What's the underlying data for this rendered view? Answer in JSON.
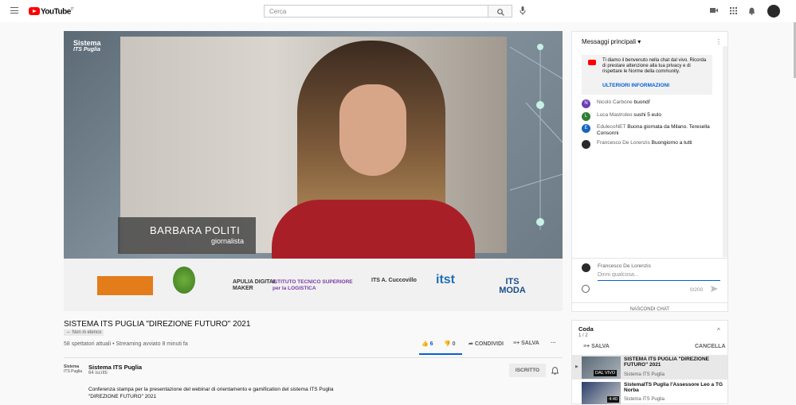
{
  "header": {
    "logo_text": "YouTube",
    "logo_sup": "IT",
    "search_placeholder": "Cerca"
  },
  "player": {
    "brand_line1": "Sistema",
    "brand_line2": "ITS Puglia",
    "lower_third_name": "BARBARA POLITI",
    "lower_third_role": "giornalista",
    "sponsors": [
      "APULIA DIGITAL MAKER",
      "ISTITUTO TECNICO SUPERIORE per la LOGISTICA",
      "ITS A. Cuccovillo",
      "itst",
      "ITS MODA"
    ]
  },
  "chat": {
    "header": "Messaggi principali",
    "welcome_text": "Ti diamo il benvenuto nella chat dal vivo. Ricorda di prestare attenzione alla tua privacy e di rispettare le Norme della community.",
    "welcome_link": "ULTERIORI INFORMAZIONI",
    "messages": [
      {
        "initial": "N",
        "author": "Nicolò Carbone",
        "text": "buondi'",
        "color": "#6a3fb5"
      },
      {
        "initial": "L",
        "author": "Luca Mastroleo",
        "text": "sushi 5 eulo",
        "color": "#2e7d32"
      },
      {
        "initial": "E",
        "author": "EdulecoNET",
        "text": "Buona giornata da Milano. Teresella Consonni",
        "color": "#1565c0"
      },
      {
        "initial": "",
        "author": "Francesco De Lorenzis",
        "text": "Buongiorno a tutti",
        "color": "#2a2a2a"
      }
    ],
    "composer_name": "Francesco De Lorenzis",
    "composer_placeholder": "Dinni qualcosa...",
    "char_count": "0/200",
    "hide_chat": "NASCONDI CHAT"
  },
  "video": {
    "title": "SISTEMA ITS PUGLIA \"DIREZIONE FUTURO\" 2021",
    "visibility": "Non in elenco",
    "meta": "58 spettatori attuali • Streaming avviato 8 minuti fa",
    "likes": "6",
    "dislikes": "0",
    "share": "CONDIVIDI",
    "save": "SALVA",
    "channel": "Sistema ITS Puglia",
    "subscribers": "64 iscritti",
    "subscribed": "ISCRITTO",
    "description": "Conferenza stampa per la presentazione del webinar di orientamento e gamification del sistema ITS Puglia \"DIREZIONE FUTURO\" 2021"
  },
  "queue": {
    "title": "Coda",
    "count": "1 / 2",
    "save": "SALVA",
    "cancel": "CANCELLA",
    "items": [
      {
        "title": "SISTEMA ITS PUGLIA \"DIREZIONE FUTURO\" 2021",
        "channel": "Sistema ITS Puglia",
        "badge": "DAL VIVO"
      },
      {
        "title": "SistemaITS Puglia l'Assessore Leo a TG Norba",
        "channel": "Sistema ITS Puglia",
        "badge": "4:40"
      }
    ]
  }
}
